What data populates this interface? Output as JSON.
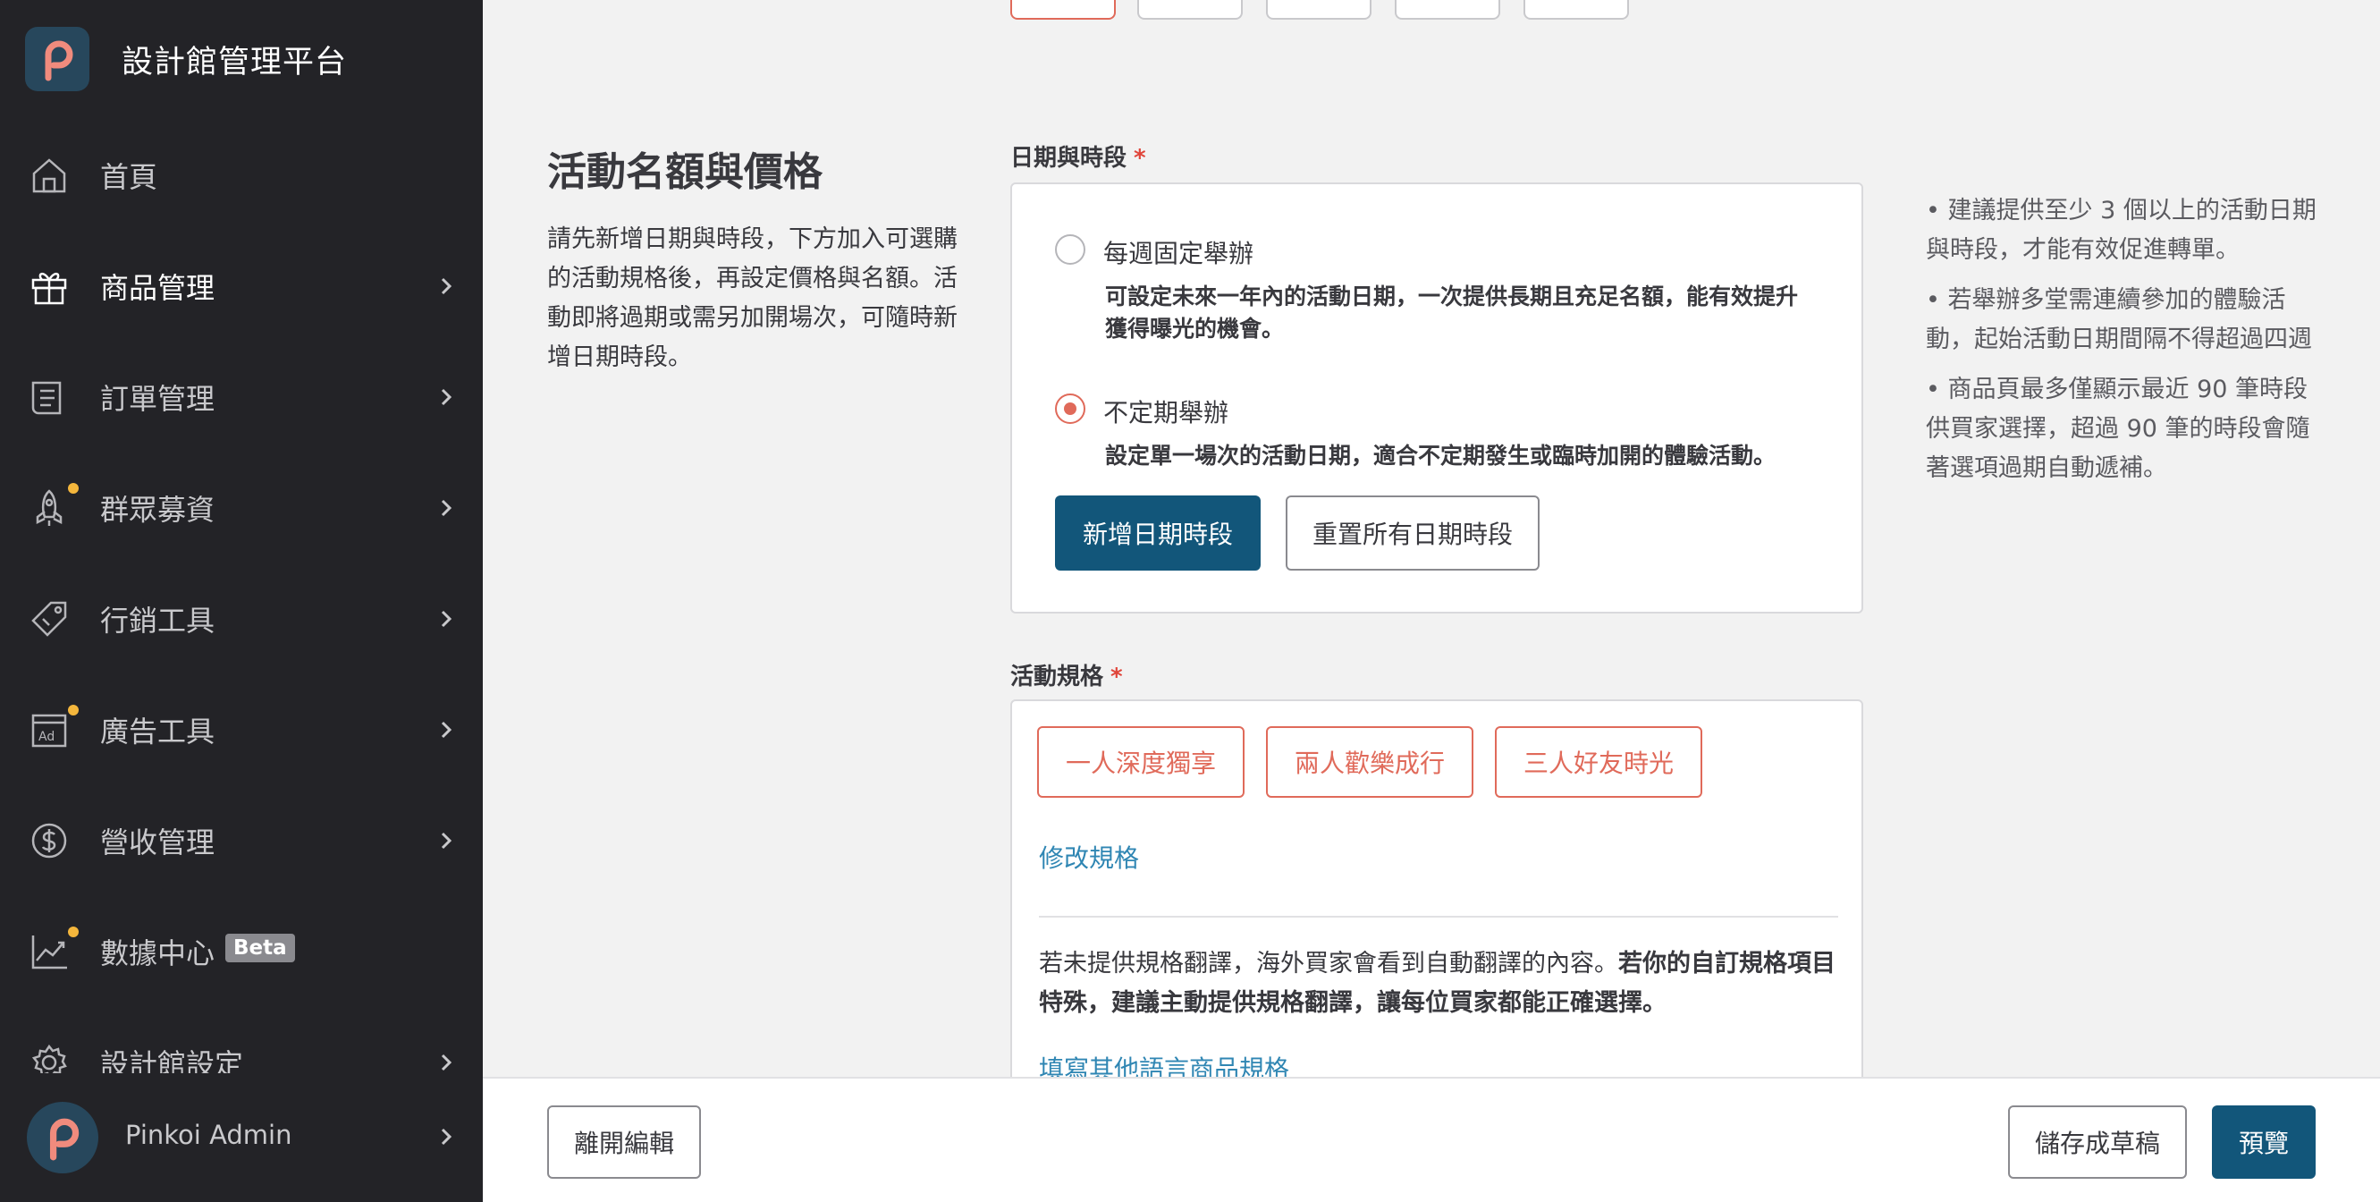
{
  "app": {
    "title": "設計館管理平台"
  },
  "sidebar": {
    "items": [
      {
        "label": "首頁",
        "icon": "home-icon",
        "has_chevron": false,
        "dot": false
      },
      {
        "label": "商品管理",
        "icon": "gift-icon",
        "has_chevron": true,
        "dot": false,
        "active": true
      },
      {
        "label": "訂單管理",
        "icon": "receipt-icon",
        "has_chevron": true,
        "dot": false
      },
      {
        "label": "群眾募資",
        "icon": "rocket-icon",
        "has_chevron": true,
        "dot": true
      },
      {
        "label": "行銷工具",
        "icon": "tag-icon",
        "has_chevron": true,
        "dot": false
      },
      {
        "label": "廣告工具",
        "icon": "ad-icon",
        "has_chevron": true,
        "dot": true
      },
      {
        "label": "營收管理",
        "icon": "dollar-icon",
        "has_chevron": true,
        "dot": false
      },
      {
        "label": "數據中心",
        "icon": "chart-icon",
        "has_chevron": false,
        "dot": true,
        "badge": "Beta"
      },
      {
        "label": "設計館設定",
        "icon": "gear-icon",
        "has_chevron": true,
        "dot": false
      }
    ],
    "user": {
      "name": "Pinkoi Admin"
    }
  },
  "section": {
    "title": "活動名額與價格",
    "description": "請先新增日期與時段，下方加入可選購的活動規格後，再設定價格與名額。活動即將過期或需另加開場次，可隨時新增日期時段。"
  },
  "schedule": {
    "label": "日期與時段",
    "required_mark": "*",
    "options": [
      {
        "label": "每週固定舉辦",
        "desc": "可設定未來一年內的活動日期，一次提供長期且充足名額，能有效提升獲得曝光的機會。",
        "checked": false
      },
      {
        "label": "不定期舉辦",
        "desc": "設定單一場次的活動日期，適合不定期發生或臨時加開的體驗活動。",
        "checked": true
      }
    ],
    "add_button": "新增日期時段",
    "reset_button": "重置所有日期時段"
  },
  "spec": {
    "label": "活動規格",
    "required_mark": "*",
    "chips": [
      "一人深度獨享",
      "兩人歡樂成行",
      "三人好友時光"
    ],
    "edit_link": "修改規格",
    "note_plain": "若未提供規格翻譯，海外買家會看到自動翻譯的內容。",
    "note_bold": "若你的自訂規格項目特殊，建議主動提供規格翻譯，讓每位買家都能正確選擇。",
    "translate_link": "填寫其他語言商品規格"
  },
  "tips": [
    "• 建議提供至少 3 個以上的活動日期與時段，才能有效促進轉單。",
    "• 若舉辦多堂需連續參加的體驗活動，起始活動日期間隔不得超過四週",
    "• 商品頁最多僅顯示最近 90 筆時段供買家選擇，超過 90 筆的時段會隨著選項過期自動遞補。"
  ],
  "footer": {
    "leave_button": "離開編輯",
    "draft_button": "儲存成草稿",
    "preview_button": "預覽"
  },
  "colors": {
    "sidebar_bg": "#232327",
    "primary": "#12567a",
    "accent": "#e06a5a",
    "link": "#2f86b3",
    "dot": "#f4b63c"
  }
}
